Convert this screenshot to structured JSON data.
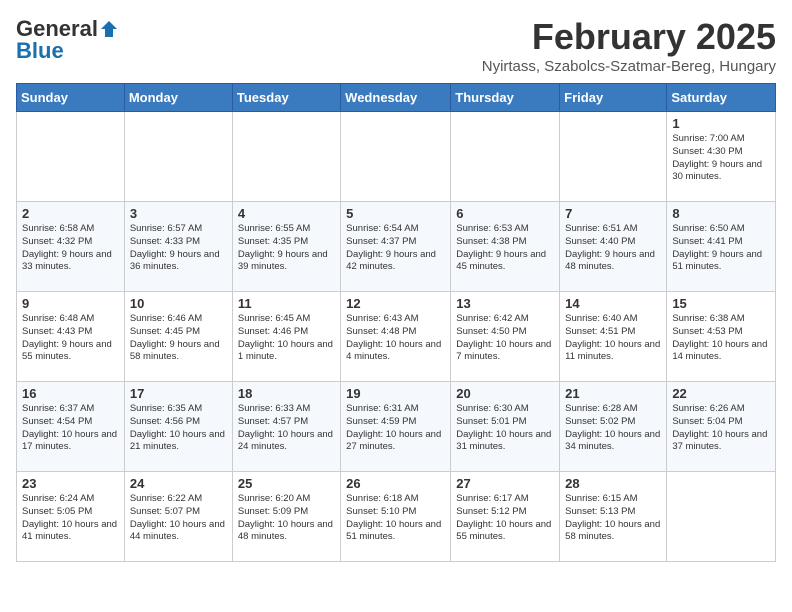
{
  "header": {
    "logo_general": "General",
    "logo_blue": "Blue",
    "title": "February 2025",
    "location": "Nyirtass, Szabolcs-Szatmar-Bereg, Hungary"
  },
  "weekdays": [
    "Sunday",
    "Monday",
    "Tuesday",
    "Wednesday",
    "Thursday",
    "Friday",
    "Saturday"
  ],
  "weeks": [
    [
      {
        "day": "",
        "info": ""
      },
      {
        "day": "",
        "info": ""
      },
      {
        "day": "",
        "info": ""
      },
      {
        "day": "",
        "info": ""
      },
      {
        "day": "",
        "info": ""
      },
      {
        "day": "",
        "info": ""
      },
      {
        "day": "1",
        "info": "Sunrise: 7:00 AM\nSunset: 4:30 PM\nDaylight: 9 hours and 30 minutes."
      }
    ],
    [
      {
        "day": "2",
        "info": "Sunrise: 6:58 AM\nSunset: 4:32 PM\nDaylight: 9 hours and 33 minutes."
      },
      {
        "day": "3",
        "info": "Sunrise: 6:57 AM\nSunset: 4:33 PM\nDaylight: 9 hours and 36 minutes."
      },
      {
        "day": "4",
        "info": "Sunrise: 6:55 AM\nSunset: 4:35 PM\nDaylight: 9 hours and 39 minutes."
      },
      {
        "day": "5",
        "info": "Sunrise: 6:54 AM\nSunset: 4:37 PM\nDaylight: 9 hours and 42 minutes."
      },
      {
        "day": "6",
        "info": "Sunrise: 6:53 AM\nSunset: 4:38 PM\nDaylight: 9 hours and 45 minutes."
      },
      {
        "day": "7",
        "info": "Sunrise: 6:51 AM\nSunset: 4:40 PM\nDaylight: 9 hours and 48 minutes."
      },
      {
        "day": "8",
        "info": "Sunrise: 6:50 AM\nSunset: 4:41 PM\nDaylight: 9 hours and 51 minutes."
      }
    ],
    [
      {
        "day": "9",
        "info": "Sunrise: 6:48 AM\nSunset: 4:43 PM\nDaylight: 9 hours and 55 minutes."
      },
      {
        "day": "10",
        "info": "Sunrise: 6:46 AM\nSunset: 4:45 PM\nDaylight: 9 hours and 58 minutes."
      },
      {
        "day": "11",
        "info": "Sunrise: 6:45 AM\nSunset: 4:46 PM\nDaylight: 10 hours and 1 minute."
      },
      {
        "day": "12",
        "info": "Sunrise: 6:43 AM\nSunset: 4:48 PM\nDaylight: 10 hours and 4 minutes."
      },
      {
        "day": "13",
        "info": "Sunrise: 6:42 AM\nSunset: 4:50 PM\nDaylight: 10 hours and 7 minutes."
      },
      {
        "day": "14",
        "info": "Sunrise: 6:40 AM\nSunset: 4:51 PM\nDaylight: 10 hours and 11 minutes."
      },
      {
        "day": "15",
        "info": "Sunrise: 6:38 AM\nSunset: 4:53 PM\nDaylight: 10 hours and 14 minutes."
      }
    ],
    [
      {
        "day": "16",
        "info": "Sunrise: 6:37 AM\nSunset: 4:54 PM\nDaylight: 10 hours and 17 minutes."
      },
      {
        "day": "17",
        "info": "Sunrise: 6:35 AM\nSunset: 4:56 PM\nDaylight: 10 hours and 21 minutes."
      },
      {
        "day": "18",
        "info": "Sunrise: 6:33 AM\nSunset: 4:57 PM\nDaylight: 10 hours and 24 minutes."
      },
      {
        "day": "19",
        "info": "Sunrise: 6:31 AM\nSunset: 4:59 PM\nDaylight: 10 hours and 27 minutes."
      },
      {
        "day": "20",
        "info": "Sunrise: 6:30 AM\nSunset: 5:01 PM\nDaylight: 10 hours and 31 minutes."
      },
      {
        "day": "21",
        "info": "Sunrise: 6:28 AM\nSunset: 5:02 PM\nDaylight: 10 hours and 34 minutes."
      },
      {
        "day": "22",
        "info": "Sunrise: 6:26 AM\nSunset: 5:04 PM\nDaylight: 10 hours and 37 minutes."
      }
    ],
    [
      {
        "day": "23",
        "info": "Sunrise: 6:24 AM\nSunset: 5:05 PM\nDaylight: 10 hours and 41 minutes."
      },
      {
        "day": "24",
        "info": "Sunrise: 6:22 AM\nSunset: 5:07 PM\nDaylight: 10 hours and 44 minutes."
      },
      {
        "day": "25",
        "info": "Sunrise: 6:20 AM\nSunset: 5:09 PM\nDaylight: 10 hours and 48 minutes."
      },
      {
        "day": "26",
        "info": "Sunrise: 6:18 AM\nSunset: 5:10 PM\nDaylight: 10 hours and 51 minutes."
      },
      {
        "day": "27",
        "info": "Sunrise: 6:17 AM\nSunset: 5:12 PM\nDaylight: 10 hours and 55 minutes."
      },
      {
        "day": "28",
        "info": "Sunrise: 6:15 AM\nSunset: 5:13 PM\nDaylight: 10 hours and 58 minutes."
      },
      {
        "day": "",
        "info": ""
      }
    ]
  ]
}
